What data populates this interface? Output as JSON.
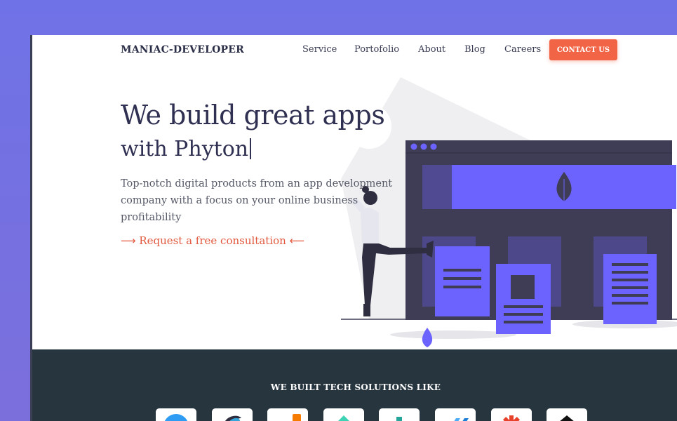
{
  "nav": {
    "brand": "MANIAC-DEVELOPER",
    "items": [
      {
        "label": "Service"
      },
      {
        "label": "Portofolio"
      },
      {
        "label": "About"
      },
      {
        "label": "Blog"
      },
      {
        "label": "Careers"
      }
    ],
    "contact_label": "CONTACT US"
  },
  "hero": {
    "title_line1": "We build great apps",
    "title_line2": "with Phyton",
    "description": "Top-notch digital products from an app development company with a focus on your online business profitability",
    "cta_label": "Request a free consultation",
    "cta_arrow_left": "⟶",
    "cta_arrow_right": "⟵"
  },
  "tech": {
    "title": "WE BUILT TECH SOLUTIONS LIKE",
    "logos": [
      {
        "icon": "blue-circle-logo-icon"
      },
      {
        "icon": "swirl-logo-icon"
      },
      {
        "icon": "orange-bars-logo-icon"
      },
      {
        "icon": "teal-diamond-logo-icon"
      },
      {
        "icon": "teal-plus-logo-icon"
      },
      {
        "icon": "blue-stripes-logo-icon"
      },
      {
        "icon": "red-asterisk-logo-icon"
      },
      {
        "icon": "black-chevron-logo-icon"
      }
    ]
  },
  "colors": {
    "background_gradient": "#6f72e6",
    "accent": "#f26446",
    "illustration_purple": "#6c63ff",
    "illustration_dark": "#3f3d56",
    "footer_band": "#27353f",
    "heading": "#2f3052"
  }
}
